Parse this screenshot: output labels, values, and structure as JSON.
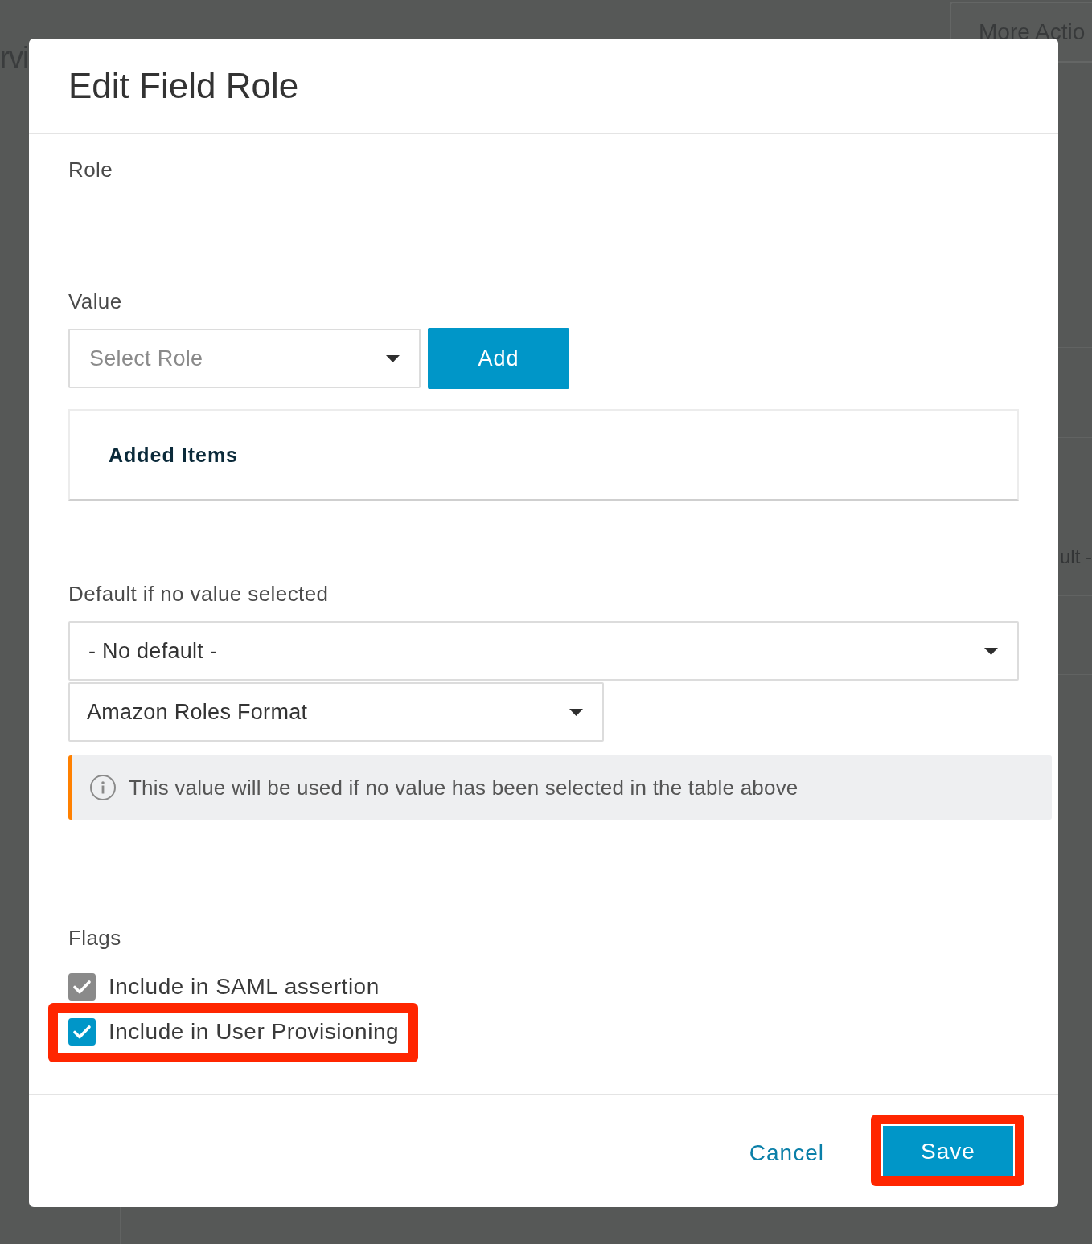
{
  "background": {
    "page_title": "rvi",
    "actions_button": "More Actio",
    "table_cell": "ult -"
  },
  "dialog": {
    "title": "Edit Field Role",
    "role_label": "Role",
    "value": {
      "label": "Value",
      "select": {
        "placeholder": "Select Role"
      },
      "add_button": "Add"
    },
    "added_items": {
      "heading": "Added Items"
    },
    "default": {
      "label": "Default if no value selected",
      "select": {
        "value": "- No default -"
      },
      "format_select": {
        "value": "Amazon Roles Format"
      },
      "note": "This value will be used if no value has been selected in the table above"
    },
    "flags": {
      "label": "Flags",
      "items": [
        {
          "label": "Include in SAML assertion",
          "checked": true,
          "disabled": true,
          "highlighted": false
        },
        {
          "label": "Include in User Provisioning",
          "checked": true,
          "disabled": false,
          "highlighted": true
        }
      ]
    },
    "footer": {
      "cancel_button": "Cancel",
      "save_button": {
        "label": "Save",
        "highlighted": true
      }
    }
  }
}
